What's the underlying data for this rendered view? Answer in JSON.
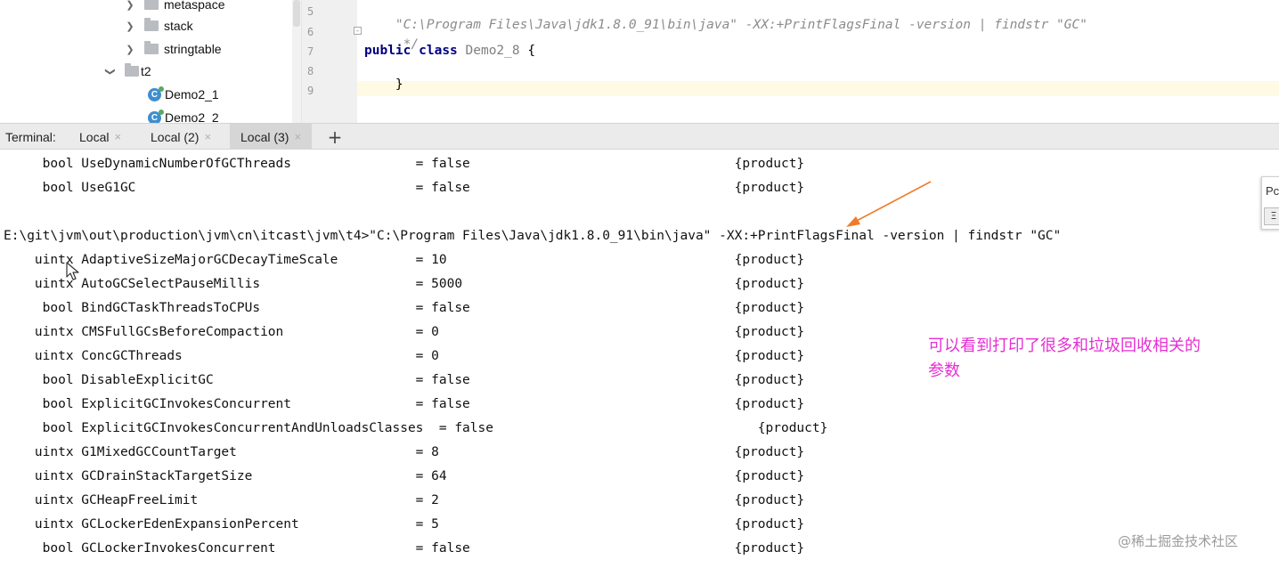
{
  "tree": {
    "items": [
      {
        "label": "metaspace",
        "type": "folder"
      },
      {
        "label": "stack",
        "type": "folder"
      },
      {
        "label": "stringtable",
        "type": "folder"
      },
      {
        "label": "t2",
        "type": "folder-open"
      },
      {
        "label": "Demo2_1",
        "type": "class"
      },
      {
        "label": "Demo2_2",
        "type": "class"
      }
    ]
  },
  "editor": {
    "lines": [
      {
        "num": "5",
        "comment": "\"C:\\Program Files\\Java\\jdk1.8.0_91\\bin\\java\" -XX:+PrintFlagsFinal -version | findstr \"GC\""
      },
      {
        "num": "6",
        "comment": " */"
      },
      {
        "num": "7",
        "kw1": "public",
        "kw2": "class",
        "cls": "Demo2_8",
        "punc": "{"
      },
      {
        "num": "8",
        "punc": "}"
      },
      {
        "num": "9"
      }
    ]
  },
  "terminal": {
    "label": "Terminal:",
    "tabs": [
      {
        "label": "Local",
        "close": "×"
      },
      {
        "label": "Local (2)",
        "close": "×"
      },
      {
        "label": "Local (3)",
        "close": "×"
      }
    ],
    "add": "+",
    "lines": [
      "     bool UseDynamicNumberOfGCThreads                = false                                  {product}",
      "     bool UseG1GC                                    = false                                  {product}",
      "",
      "E:\\git\\jvm\\out\\production\\jvm\\cn\\itcast\\jvm\\t4>\"C:\\Program Files\\Java\\jdk1.8.0_91\\bin\\java\" -XX:+PrintFlagsFinal -version | findstr \"GC\"",
      "    uintx AdaptiveSizeMajorGCDecayTimeScale          = 10                                     {product}",
      "    uintx AutoGCSelectPauseMillis                    = 5000                                   {product}",
      "     bool BindGCTaskThreadsToCPUs                    = false                                  {product}",
      "    uintx CMSFullGCsBeforeCompaction                 = 0                                      {product}",
      "    uintx ConcGCThreads                              = 0                                      {product}",
      "     bool DisableExplicitGC                          = false                                  {product}",
      "     bool ExplicitGCInvokesConcurrent                = false                                  {product}",
      "     bool ExplicitGCInvokesConcurrentAndUnloadsClasses  = false                                  {product}",
      "    uintx G1MixedGCCountTarget                       = 8                                      {product}",
      "    uintx GCDrainStackTargetSize                     = 64                                     {product}",
      "    uintx GCHeapFreeLimit                            = 2                                      {product}",
      "    uintx GCLockerEdenExpansionPercent               = 5                                      {product}",
      "     bool GCLockerInvokesConcurrent                  = false                                  {product}"
    ]
  },
  "annotation": {
    "line1": "可以看到打印了很多和垃圾回收相关的",
    "line2": "参数",
    "color": "#e62fd3",
    "arrow_color": "#f07c2a"
  },
  "popup": {
    "label": "Pc",
    "button": "Ξ"
  },
  "watermark": "@稀土掘金技术社区"
}
